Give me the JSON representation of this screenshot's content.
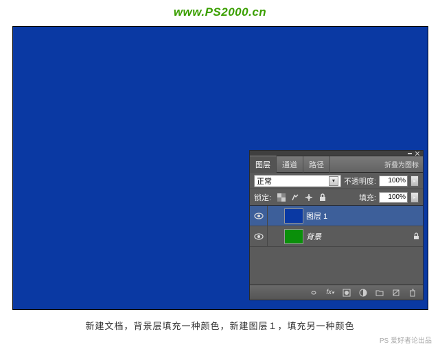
{
  "watermark": "www.PS2000.cn",
  "canvas": {
    "fill": "#0a39a3"
  },
  "panel": {
    "tabs": [
      {
        "label": "图层",
        "active": true
      },
      {
        "label": "通道",
        "active": false
      },
      {
        "label": "路径",
        "active": false
      }
    ],
    "collapse_label": "折叠为图标",
    "blend_mode": "正常",
    "opacity_label": "不透明度:",
    "opacity_value": "100%",
    "lock_label": "锁定:",
    "fill_label": "填充:",
    "fill_value": "100%",
    "layers": [
      {
        "name": "图层 1",
        "color": "blue",
        "selected": true,
        "locked": false
      },
      {
        "name": "背景",
        "color": "green",
        "selected": false,
        "locked": true,
        "italic": true
      }
    ]
  },
  "caption": "新建文档，背景层填充一种颜色，新建图层１，填充另一种颜色",
  "credit": "PS 爱好者论出品"
}
